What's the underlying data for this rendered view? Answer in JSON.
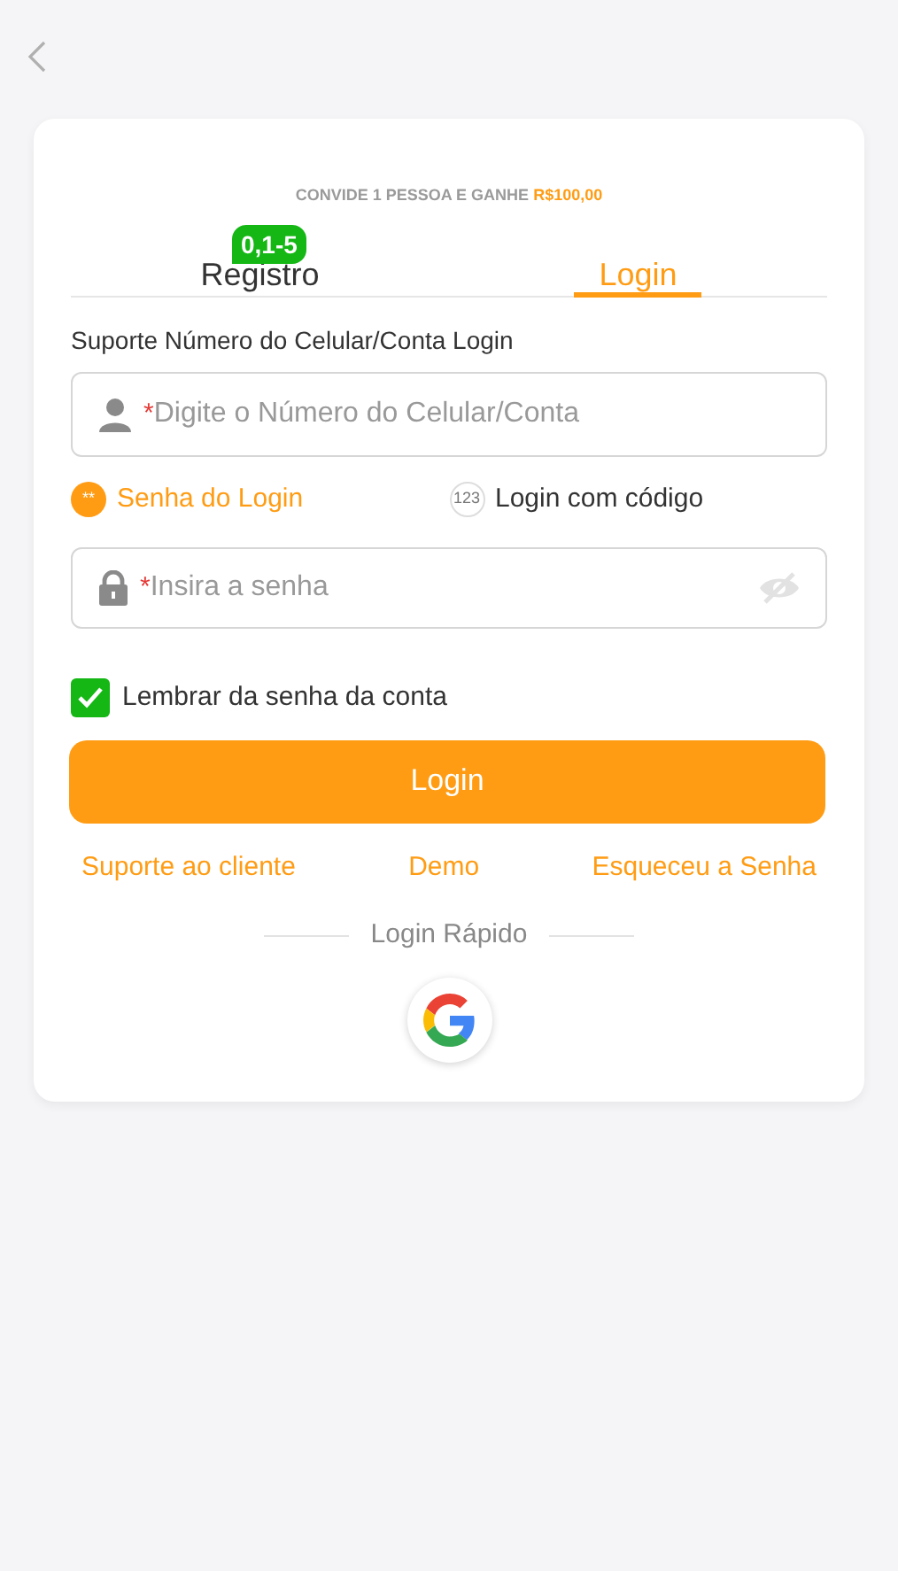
{
  "invite": {
    "text": "CONVIDE 1 PESSOA E GANHE",
    "amount": "R$100,00"
  },
  "tabs": [
    {
      "label": "Registro",
      "selected": false,
      "badge": "0,1-5"
    },
    {
      "label": "Login",
      "selected": true
    }
  ],
  "account_label": "Suporte Número do Celular/Conta Login",
  "account_field": {
    "required_mark": "*",
    "placeholder": "Digite o Número do Celular/Conta"
  },
  "login_methods": [
    {
      "icon_text": "**",
      "label": "Senha do Login",
      "selected": true
    },
    {
      "icon_text": "123",
      "label": "Login com código",
      "selected": false
    }
  ],
  "password_field": {
    "required_mark": "*",
    "placeholder": "Insira a senha"
  },
  "remember": {
    "label": "Lembrar da senha da conta",
    "checked": true
  },
  "login_button": "Login",
  "links": [
    "Suporte ao cliente",
    "Demo",
    "Esqueceu a Senha"
  ],
  "quick_login": "Login Rápido"
}
